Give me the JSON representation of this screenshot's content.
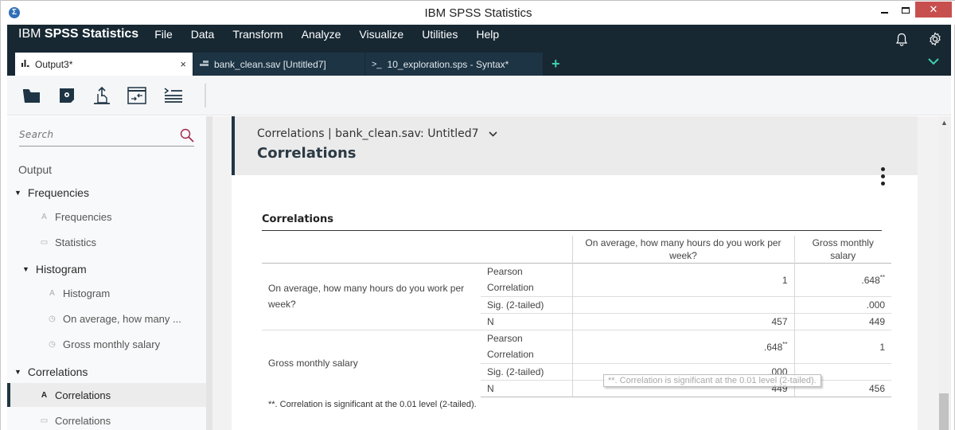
{
  "window": {
    "title": "IBM SPSS Statistics",
    "app_icon": "sigma-icon",
    "controls": {
      "minimize": "minimize",
      "maximize": "maximize",
      "close": "✕"
    }
  },
  "header": {
    "brand_prefix": "IBM",
    "brand_name": "SPSS Statistics",
    "menu": [
      "File",
      "Data",
      "Transform",
      "Analyze",
      "Visualize",
      "Utilities",
      "Help"
    ],
    "icons": [
      "bell-icon",
      "gear-icon"
    ]
  },
  "tabs": [
    {
      "label": "Output3*",
      "icon": "bar-chart-icon",
      "active": true,
      "close": "×"
    },
    {
      "label": "bank_clean.sav [Untitled7]",
      "icon": "data-grid-icon",
      "active": false
    },
    {
      "label": "10_exploration.sps - Syntax*",
      "icon": "terminal-icon",
      "active": false
    }
  ],
  "tabs_extra": {
    "add": "+",
    "menu": "chevron-down"
  },
  "toolbar": {
    "buttons": [
      "open-folder",
      "save",
      "export",
      "collapse",
      "outline-list"
    ]
  },
  "sidebar": {
    "search_placeholder": "Search",
    "tree": [
      {
        "label": "Output",
        "level": 0
      },
      {
        "label": "Frequencies",
        "level": 1,
        "expanded": true
      },
      {
        "label": "Frequencies",
        "level": 2,
        "icon": "title-icon"
      },
      {
        "label": "Statistics",
        "level": 2,
        "icon": "table-icon"
      },
      {
        "label": "Histogram",
        "level": 1,
        "expanded": true
      },
      {
        "label": "Histogram",
        "level": 2,
        "icon": "title-icon"
      },
      {
        "label": "On average, how many ...",
        "level": 2,
        "icon": "chart-icon"
      },
      {
        "label": "Gross monthly salary",
        "level": 2,
        "icon": "chart-icon"
      },
      {
        "label": "Correlations",
        "level": 1,
        "expanded": true
      },
      {
        "label": "Correlations",
        "level": 2,
        "icon": "title-icon",
        "selected": true
      },
      {
        "label": "Correlations",
        "level": 2,
        "icon": "table-icon"
      }
    ]
  },
  "content": {
    "breadcrumb": "Correlations | bank_clean.sav: Untitled7",
    "title": "Correlations",
    "table": {
      "title": "Correlations",
      "columns": [
        "On average, how many hours do you work per week?",
        "Gross monthly salary"
      ],
      "rows": [
        {
          "label": "On average, how many hours do you work per week?",
          "stats": [
            {
              "name": "Pearson Correlation",
              "values": [
                "1",
                ".648"
              ],
              "sup": [
                "",
                "**"
              ]
            },
            {
              "name": "Sig. (2-tailed)",
              "values": [
                "",
                ".000"
              ]
            },
            {
              "name": "N",
              "values": [
                "457",
                "449"
              ]
            }
          ]
        },
        {
          "label": "Gross monthly salary",
          "stats": [
            {
              "name": "Pearson Correlation",
              "values": [
                ".648",
                "1"
              ],
              "sup": [
                "**",
                ""
              ]
            },
            {
              "name": "Sig. (2-tailed)",
              "values": [
                ".000",
                ""
              ]
            },
            {
              "name": "N",
              "values": [
                "449",
                "456"
              ]
            }
          ]
        }
      ],
      "footnote": "**. Correlation is significant at the 0.01 level (2-tailed).",
      "tooltip": "**. Correlation is significant at the 0.01 level (2-tailed)."
    }
  }
}
